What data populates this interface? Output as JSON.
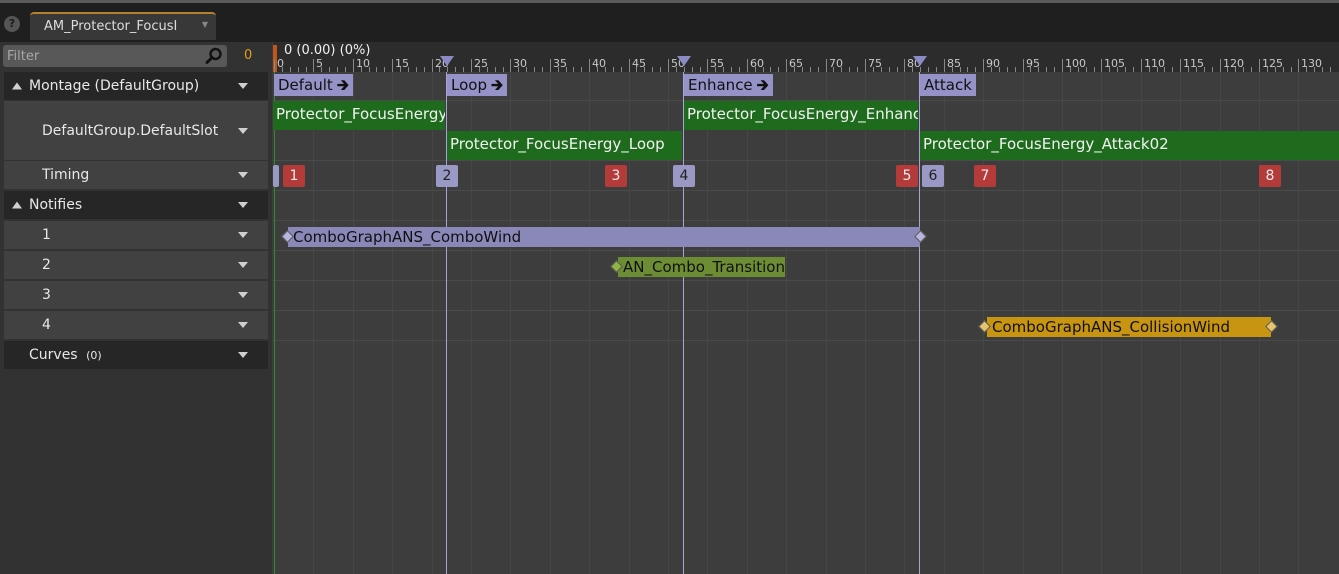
{
  "tab": {
    "title": "AM_Protector_FocusI"
  },
  "filter": {
    "placeholder": "Filter",
    "value": ""
  },
  "frame_value": "0",
  "ruler": {
    "readout": "0 (0.00) (0%)",
    "labels": [
      "0",
      "5",
      "10",
      "15",
      "20",
      "25",
      "30",
      "35",
      "40",
      "45",
      "50",
      "55",
      "60",
      "65",
      "70",
      "75",
      "80",
      "85",
      "90",
      "95",
      "100",
      "105",
      "110",
      "115",
      "120",
      "125",
      "130"
    ]
  },
  "tracks": {
    "montage": "Montage (DefaultGroup)",
    "slot": "DefaultGroup.DefaultSlot",
    "timing": "Timing",
    "notifies": "Notifies",
    "notify_rows": [
      "1",
      "2",
      "3",
      "4"
    ],
    "curves": "Curves",
    "curves_count": "(0)"
  },
  "sections": [
    {
      "name": "Default",
      "has_arrow": true
    },
    {
      "name": "Loop",
      "has_arrow": true
    },
    {
      "name": "Enhance",
      "has_arrow": true
    },
    {
      "name": "Attack",
      "has_arrow": false
    }
  ],
  "segments": [
    {
      "label": "Protector_FocusEnergy",
      "row": 1
    },
    {
      "label": "Protector_FocusEnergy_Loop",
      "row": 2
    },
    {
      "label": "Protector_FocusEnergy_Enhance",
      "row": 1
    },
    {
      "label": "Protector_FocusEnergy_Attack02",
      "row": 2
    }
  ],
  "timing_badges": [
    {
      "label": "1",
      "kind": "red"
    },
    {
      "label": "2",
      "kind": "blue"
    },
    {
      "label": "3",
      "kind": "red"
    },
    {
      "label": "4",
      "kind": "blue"
    },
    {
      "label": "5",
      "kind": "red"
    },
    {
      "label": "6",
      "kind": "blue"
    },
    {
      "label": "7",
      "kind": "red"
    },
    {
      "label": "8",
      "kind": "red"
    }
  ],
  "notifies": [
    {
      "label": "ComboGraphANS_ComboWind",
      "track": 1
    },
    {
      "label": "AN_Combo_Transition",
      "track": 2
    },
    {
      "label": "ComboGraphANS_CollisionWind",
      "track": 4
    }
  ],
  "colors": {
    "section_header": "#9592c8",
    "segment": "#1e6b1d",
    "notify_1": "#8a88b8",
    "notify_2": "#6d8d34",
    "notify_4": "#c89512",
    "badge_red": "#b53a3a",
    "badge_blue": "#9a98c4",
    "accent_orange": "#e79a1b"
  }
}
